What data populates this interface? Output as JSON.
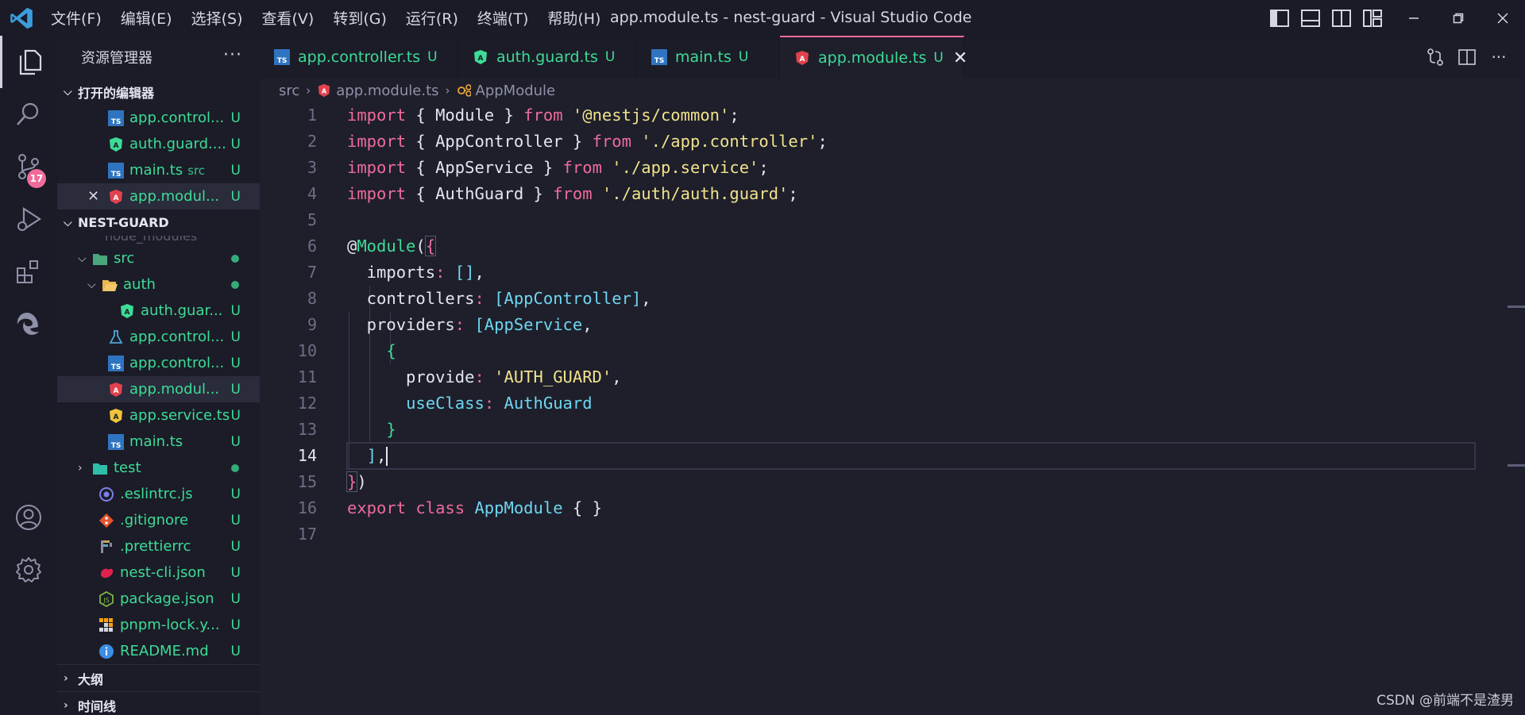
{
  "menu": [
    "文件(F)",
    "编辑(E)",
    "选择(S)",
    "查看(V)",
    "转到(G)",
    "运行(R)",
    "终端(T)",
    "帮助(H)"
  ],
  "window_title": "app.module.ts - nest-guard - Visual Studio Code",
  "activity": {
    "badge": "17"
  },
  "explorer": {
    "title": "资源管理器",
    "open_editors_title": "打开的编辑器",
    "open_editors": [
      {
        "name": "app.control...",
        "icon": "typescript-icon",
        "status": "U",
        "sub": ""
      },
      {
        "name": "auth.guard....",
        "icon": "angular-guard-icon",
        "status": "U",
        "sub": ""
      },
      {
        "name": "main.ts",
        "icon": "typescript-icon",
        "status": "U",
        "sub": "src"
      },
      {
        "name": "app.modul...",
        "icon": "angular-module-icon",
        "status": "U",
        "sub": "",
        "selected": true
      }
    ],
    "project_title": "NEST-GUARD",
    "ghost_row": "node_modules",
    "tree": {
      "src": "src",
      "auth": "auth",
      "auth_guard": "auth.guar...",
      "app_controller_spec": "app.control...",
      "app_controller": "app.control...",
      "app_module": "app.modul...",
      "app_service": "app.service.ts",
      "main": "main.ts",
      "test": "test",
      "eslintrc": ".eslintrc.js",
      "gitignore": ".gitignore",
      "prettierrc": ".prettierrc",
      "nest_cli": "nest-cli.json",
      "package": "package.json",
      "pnpm_lock": "pnpm-lock.y...",
      "readme": "README.md",
      "status": "U"
    },
    "outline_title": "大纲",
    "timeline_title": "时间线"
  },
  "tabs": [
    {
      "label": "app.controller.ts",
      "status": "U",
      "icon": "typescript-icon"
    },
    {
      "label": "auth.guard.ts",
      "status": "U",
      "icon": "angular-guard-icon"
    },
    {
      "label": "main.ts",
      "status": "U",
      "icon": "typescript-icon"
    },
    {
      "label": "app.module.ts",
      "status": "U",
      "icon": "angular-module-icon",
      "active": true
    }
  ],
  "breadcrumb": {
    "folder": "src",
    "file": "app.module.ts",
    "symbol": "AppModule"
  },
  "editor": {
    "line_numbers": [
      "1",
      "2",
      "3",
      "4",
      "5",
      "6",
      "7",
      "8",
      "9",
      "10",
      "11",
      "12",
      "13",
      "14",
      "15",
      "16",
      "17"
    ],
    "current_line": "14",
    "code": {
      "l1": [
        "import",
        " { Module } ",
        "from",
        " ",
        "'@nestjs/common'",
        ";"
      ],
      "l2": [
        "import",
        " { AppController } ",
        "from",
        " ",
        "'./app.controller'",
        ";"
      ],
      "l3": [
        "import",
        " { AppService } ",
        "from",
        " ",
        "'./app.service'",
        ";"
      ],
      "l4": [
        "import",
        " { AuthGuard } ",
        "from",
        " ",
        "'./auth/auth.guard'",
        ";"
      ],
      "l6": [
        "@",
        "Module",
        "(",
        "{"
      ],
      "l7": [
        "  imports",
        ": ",
        "[]",
        ","
      ],
      "l8": [
        "  controllers",
        ": ",
        "[",
        "AppController",
        "]",
        ","
      ],
      "l9": [
        "  providers",
        ": ",
        "[",
        "AppService",
        ","
      ],
      "l10": [
        "    ",
        "{"
      ],
      "l11": [
        "      provide",
        ": ",
        "'AUTH_GUARD'",
        ","
      ],
      "l12": [
        "      ",
        "useClass",
        ": ",
        "AuthGuard"
      ],
      "l13": [
        "    ",
        "}"
      ],
      "l14": [
        "  ",
        "]",
        ","
      ],
      "l15": [
        "}",
        ")"
      ],
      "l16": [
        "export",
        " ",
        "class",
        " ",
        "AppModule",
        " { }"
      ]
    }
  },
  "watermark": "CSDN @前端不是渣男",
  "colors": {
    "accent": "#ef6b9b",
    "git_untracked": "#3ddc97",
    "string": "#f1e28c",
    "type": "#6fd6f0"
  }
}
